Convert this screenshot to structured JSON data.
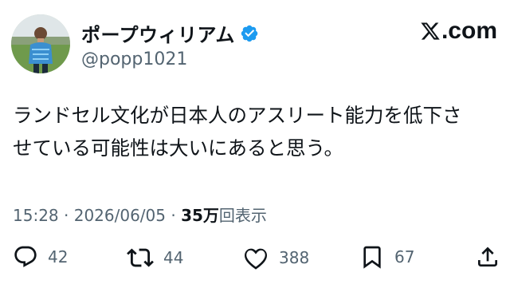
{
  "user": {
    "display_name": "ポープウィリアム",
    "handle": "@popp1021",
    "verified": true,
    "verified_color": "#1d9bf0"
  },
  "brand": {
    "logo_text": ".com",
    "logo_icon": "x-logo-icon"
  },
  "tweet": {
    "text": "ランドセル文化が日本人のアスリート能力を低下さ\nせている可能性は大いにあると思う。"
  },
  "meta": {
    "time": "15:28",
    "separator": "·",
    "date": "2026/06/05",
    "views_count": "35万",
    "views_label": "回表示"
  },
  "actions": {
    "reply": {
      "icon": "reply-icon",
      "count": "42"
    },
    "repost": {
      "icon": "repost-icon",
      "count": "44"
    },
    "like": {
      "icon": "heart-icon",
      "count": "388"
    },
    "bookmark": {
      "icon": "bookmark-icon",
      "count": "67"
    },
    "share": {
      "icon": "share-icon"
    }
  },
  "colors": {
    "text_primary": "#0f1419",
    "text_secondary": "#536471",
    "background": "#ffffff"
  }
}
